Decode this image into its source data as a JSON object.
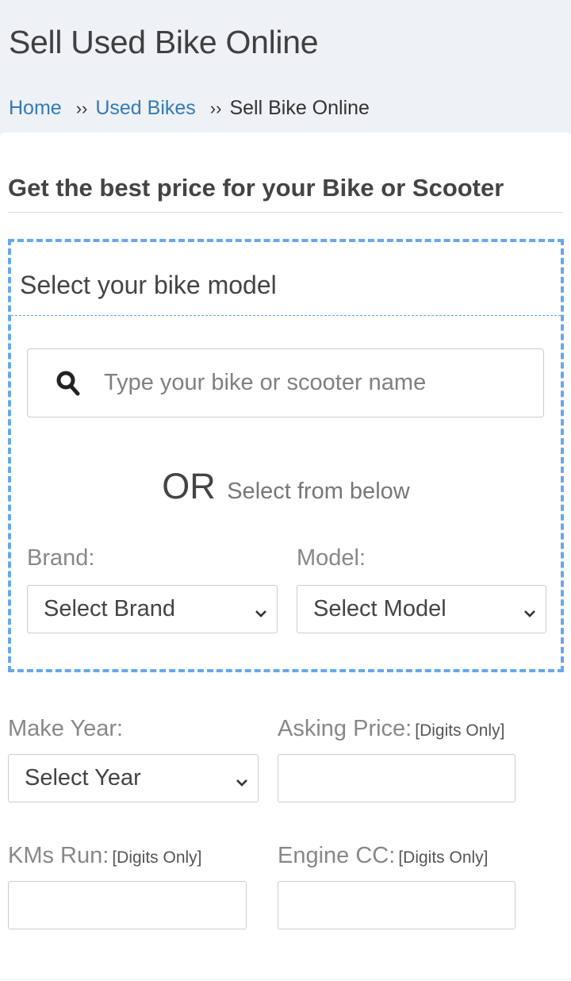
{
  "page": {
    "title": "Sell Used Bike Online"
  },
  "breadcrumb": {
    "items": [
      {
        "label": "Home",
        "link": true
      },
      {
        "label": "Used Bikes",
        "link": true
      },
      {
        "label": "Sell Bike Online",
        "link": false
      }
    ],
    "separator": "››"
  },
  "form": {
    "heading": "Get the best price for your Bike or Scooter",
    "model_section": {
      "title": "Select your bike model",
      "search_placeholder": "Type your bike or scooter name",
      "search_icon": "search-icon",
      "or_text": "OR",
      "select_below_text": "Select from below",
      "brand_label": "Brand:",
      "brand_selected": "Select Brand",
      "model_label": "Model:",
      "model_selected": "Select Model"
    },
    "make_year_label": "Make Year:",
    "make_year_selected": "Select Year",
    "asking_price_label": "Asking Price:",
    "asking_price_hint": "[Digits Only]",
    "asking_price_value": "",
    "kms_run_label": "KMs Run:",
    "kms_run_hint": "[Digits Only]",
    "kms_run_value": "",
    "engine_cc_label": "Engine CC:",
    "engine_cc_hint": "[Digits Only]",
    "engine_cc_value": ""
  },
  "colors": {
    "link": "#337ab7",
    "dashed_border": "#66a8ec",
    "page_bg": "#eef1f5"
  }
}
